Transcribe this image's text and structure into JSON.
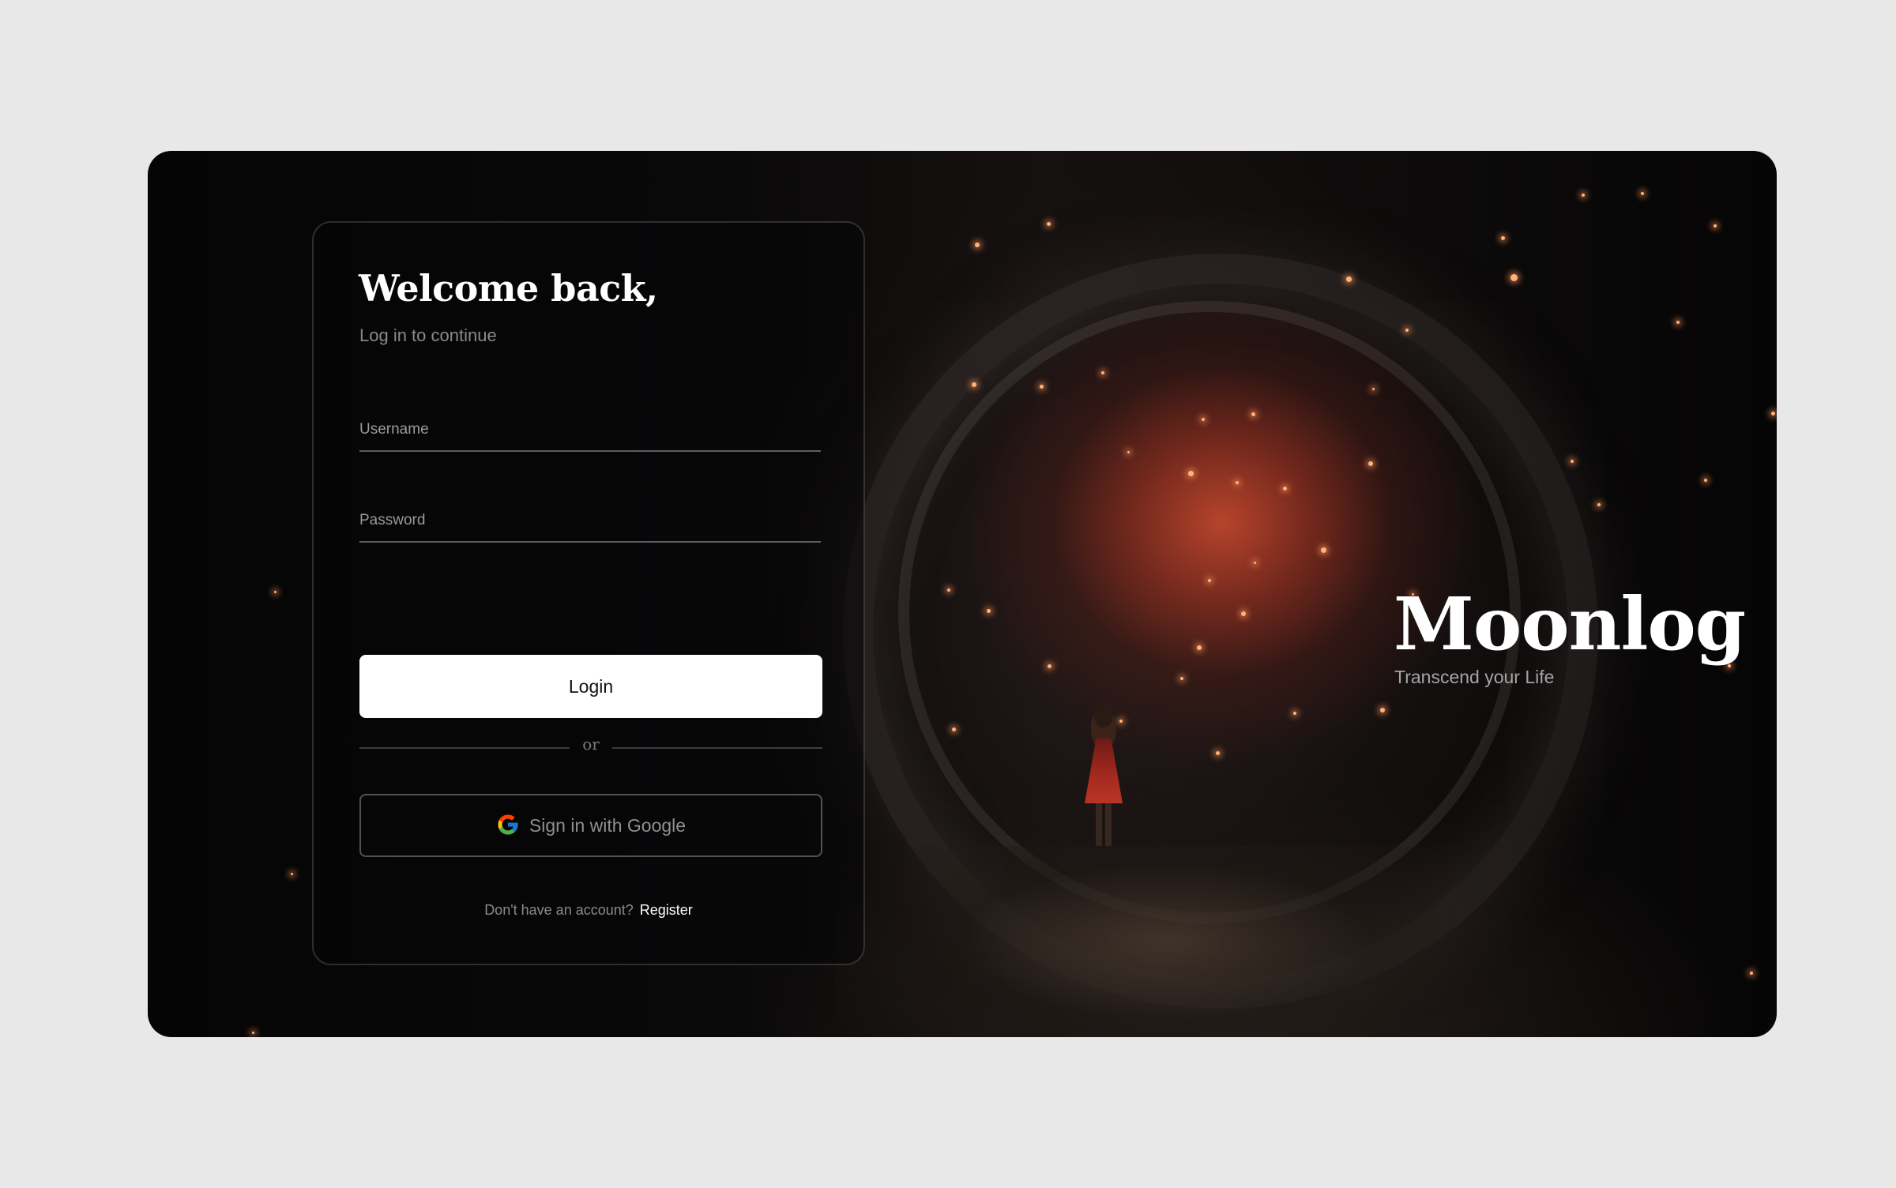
{
  "login": {
    "title": "Welcome back,",
    "subtitle": "Log in to continue",
    "username_placeholder": "Username",
    "password_placeholder": "Password",
    "login_label": "Login",
    "divider_label": "or",
    "google_label": "Sign in with Google",
    "register_prompt": "Don't have an account?",
    "register_link": "Register"
  },
  "brand": {
    "name": "Moonlog",
    "tagline": "Transcend your Life"
  },
  "icons": {
    "google": "google-icon"
  },
  "colors": {
    "background": "#e8e8e8",
    "primary_button": "#ffffff",
    "text_primary": "#ffffff",
    "text_muted": "#8a8a8a",
    "nebula_accent": "#be462d"
  }
}
